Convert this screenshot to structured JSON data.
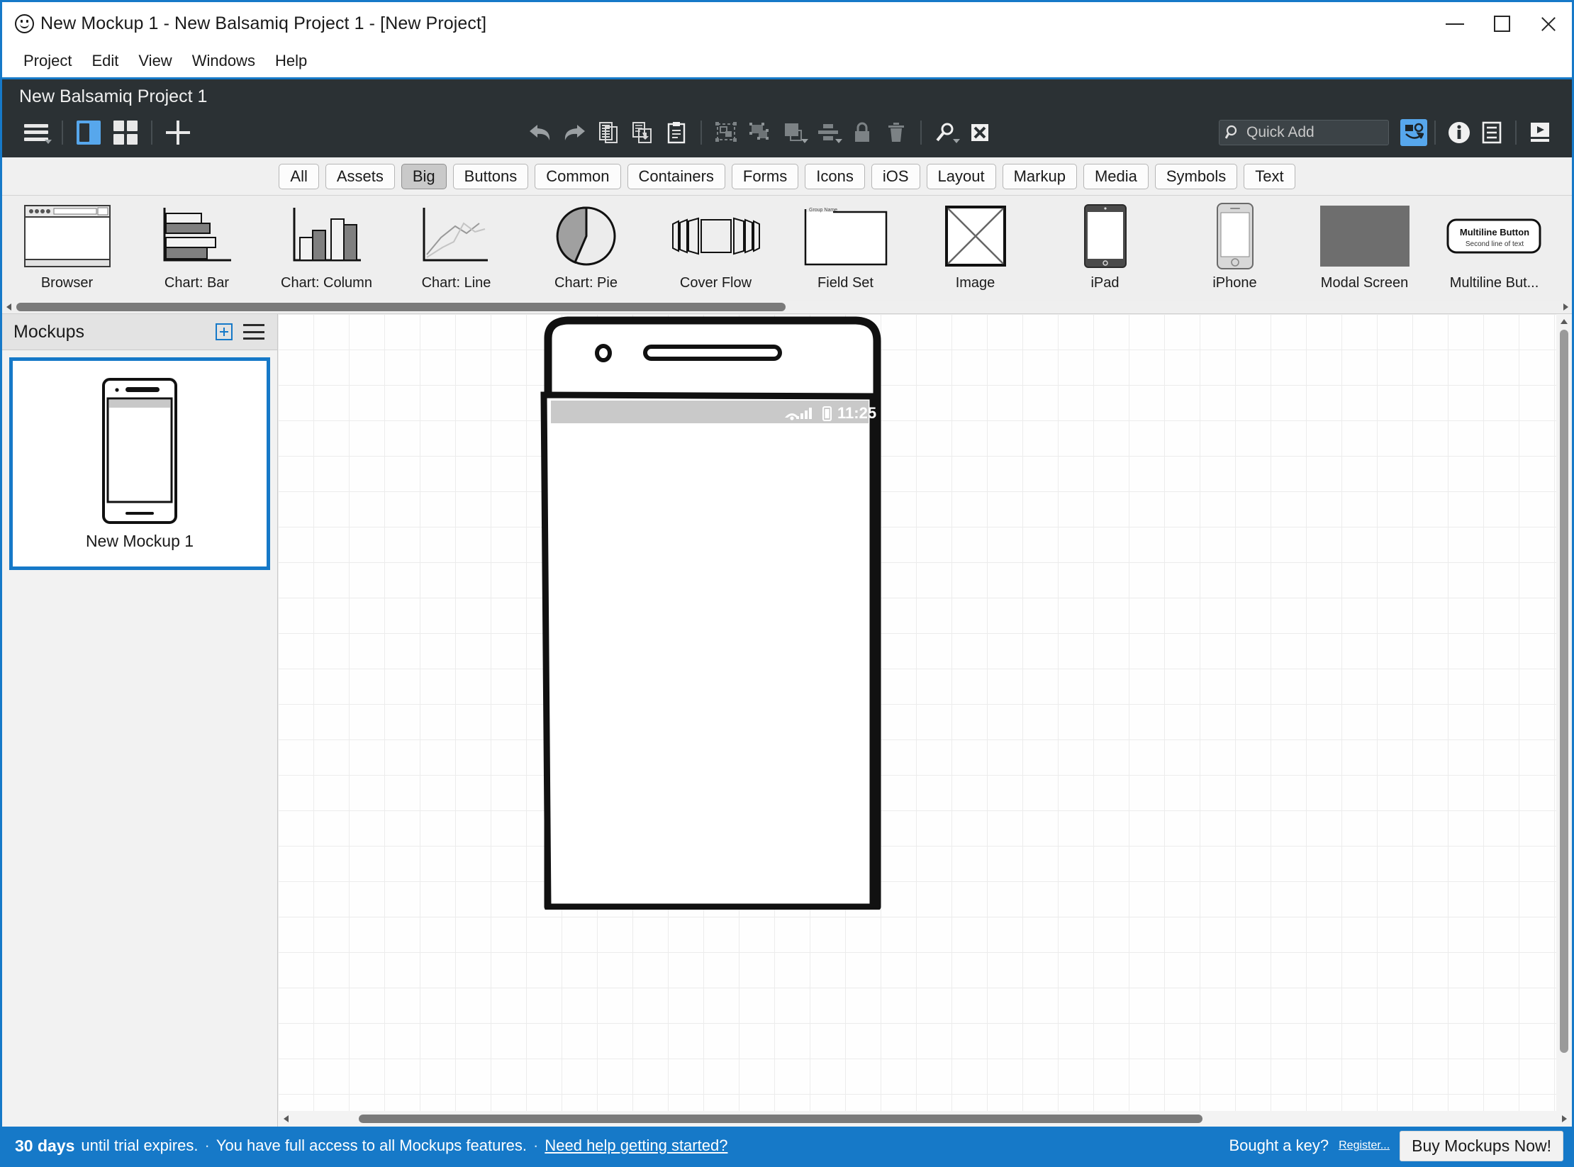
{
  "window": {
    "title": "New Mockup 1 - New Balsamiq Project 1 - [New Project]",
    "app_icon": "smiley-icon",
    "controls": {
      "minimize": "minimize-icon",
      "maximize": "maximize-icon",
      "close": "close-icon"
    }
  },
  "menubar": {
    "items": [
      "Project",
      "Edit",
      "View",
      "Windows",
      "Help"
    ]
  },
  "toolbar": {
    "project_title": "New Balsamiq Project 1",
    "left_icons": [
      {
        "name": "menu-hamburger-icon",
        "has_chevron": true
      },
      {
        "name": "panel-toggle-icon",
        "active": true
      },
      {
        "name": "grid-view-icon",
        "active": false
      },
      {
        "name": "add-new-icon",
        "active": false
      }
    ],
    "center_icons": [
      {
        "name": "undo-icon"
      },
      {
        "name": "redo-icon"
      },
      {
        "name": "copy-icon"
      },
      {
        "name": "duplicate-icon"
      },
      {
        "name": "paste-icon"
      },
      {
        "name": "group-icon"
      },
      {
        "name": "ungroup-icon"
      },
      {
        "name": "layer-order-icon",
        "has_chevron": true
      },
      {
        "name": "align-icon",
        "has_chevron": true
      },
      {
        "name": "lock-icon"
      },
      {
        "name": "delete-trash-icon"
      },
      {
        "name": "zoom-icon",
        "has_chevron": true
      },
      {
        "name": "full-screen-icon",
        "active": true
      }
    ],
    "quick_add": {
      "placeholder": "Quick Add",
      "value": "",
      "icon": "search-icon"
    },
    "right_icons": [
      {
        "name": "ui-library-icon",
        "active": true
      },
      {
        "name": "info-icon"
      },
      {
        "name": "notes-icon"
      },
      {
        "name": "presentation-play-icon"
      }
    ]
  },
  "category_tabs": {
    "items": [
      "All",
      "Assets",
      "Big",
      "Buttons",
      "Common",
      "Containers",
      "Forms",
      "Icons",
      "iOS",
      "Layout",
      "Markup",
      "Media",
      "Symbols",
      "Text"
    ],
    "active": "Big"
  },
  "palette": {
    "items": [
      {
        "label": "Browser",
        "icon": "browser-widget-icon"
      },
      {
        "label": "Chart: Bar",
        "icon": "bar-chart-widget-icon"
      },
      {
        "label": "Chart: Column",
        "icon": "column-chart-widget-icon"
      },
      {
        "label": "Chart: Line",
        "icon": "line-chart-widget-icon"
      },
      {
        "label": "Chart: Pie",
        "icon": "pie-chart-widget-icon"
      },
      {
        "label": "Cover Flow",
        "icon": "cover-flow-widget-icon"
      },
      {
        "label": "Field Set",
        "icon": "field-set-widget-icon",
        "inner_label": "Group Name"
      },
      {
        "label": "Image",
        "icon": "image-widget-icon"
      },
      {
        "label": "iPad",
        "icon": "ipad-widget-icon"
      },
      {
        "label": "iPhone",
        "icon": "iphone-widget-icon"
      },
      {
        "label": "Modal Screen",
        "icon": "modal-screen-widget-icon"
      },
      {
        "label": "Multiline But...",
        "icon": "multiline-button-widget-icon",
        "inner_label": "Multiline Button",
        "inner_label2": "Second line of text"
      }
    ]
  },
  "sidebar": {
    "title": "Mockups",
    "add_icon": "add-mockup-icon",
    "list_icon": "mockup-list-menu-icon",
    "mockups": [
      {
        "name": "New Mockup 1",
        "selected": true,
        "thumb_icon": "android-phone-thumb-icon"
      }
    ]
  },
  "canvas": {
    "phone": {
      "type": "android-phone-mockup",
      "status_bar": {
        "time": "11:25",
        "icons": [
          "wifi-icon",
          "signal-icon",
          "battery-icon"
        ]
      }
    },
    "scrollbars": {
      "vertical": "canvas-vertical-scrollbar",
      "horizontal": "canvas-horizontal-scrollbar"
    }
  },
  "trial_bar": {
    "days": "30 days",
    "until_text": "until trial expires.",
    "sep": "·",
    "access_text": "You have full access to all Mockups features.",
    "help_link": "Need help getting started?",
    "bought_text": "Bought a key?",
    "register_link": "Register...",
    "buy_button": "Buy Mockups Now!",
    "accent_color": "#1679c8"
  }
}
